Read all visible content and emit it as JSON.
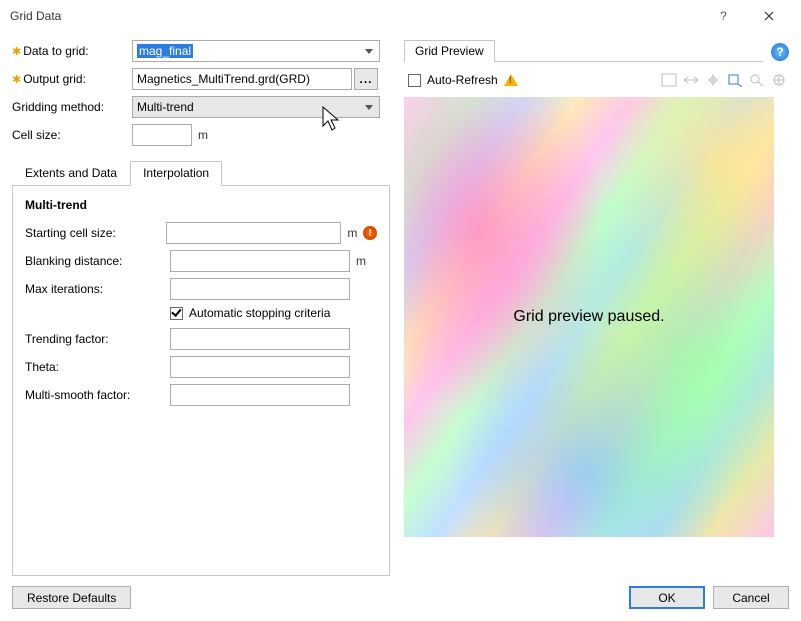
{
  "window": {
    "title": "Grid Data"
  },
  "form": {
    "data_to_grid_label": "Data to grid:",
    "data_to_grid_value": "mag_final",
    "output_grid_label": "Output grid:",
    "output_grid_value": "Magnetics_MultiTrend.grd(GRD)",
    "gridding_method_label": "Gridding method:",
    "gridding_method_value": "Multi-trend",
    "cell_size_label": "Cell size:",
    "cell_size_value": "",
    "unit_m": "m",
    "browse_label": "..."
  },
  "tabs": {
    "extents": "Extents and Data",
    "interp": "Interpolation"
  },
  "interp": {
    "section_title": "Multi-trend",
    "starting_cell_label": "Starting cell size:",
    "starting_cell_value": "",
    "blanking_label": "Blanking distance:",
    "blanking_value": "",
    "max_iter_label": "Max iterations:",
    "max_iter_value": "",
    "auto_stop_label": "Automatic stopping criteria",
    "trending_label": "Trending factor:",
    "trending_value": "",
    "theta_label": "Theta:",
    "theta_value": "",
    "smooth_label": "Multi-smooth factor:",
    "smooth_value": ""
  },
  "preview": {
    "tab_label": "Grid Preview",
    "auto_refresh_label": "Auto-Refresh",
    "overlay_text": "Grid preview paused."
  },
  "buttons": {
    "restore": "Restore Defaults",
    "ok": "OK",
    "cancel": "Cancel"
  }
}
